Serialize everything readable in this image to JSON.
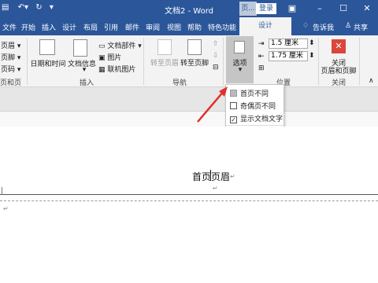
{
  "titlebar": {
    "doc_title": "文档2 - Word",
    "context_tab_label": "页...",
    "login": "登录",
    "ribbon_display": "▣",
    "minimize": "–",
    "restore": "☐",
    "close": "✕"
  },
  "tabs": [
    "文件",
    "开始",
    "插入",
    "设计",
    "布局",
    "引用",
    "邮件",
    "审阅",
    "视图",
    "帮助",
    "特色功能"
  ],
  "design_tab": "设计",
  "tell_me": "告诉我",
  "share": "共享",
  "ribbon": {
    "header_footer": [
      "页眉 ▾",
      "页脚 ▾",
      "页码 ▾"
    ],
    "header_footer_group": "页和页脚",
    "date_time": "日期和时间",
    "doc_info": "文档信息",
    "doc_parts": "文档部件 ▾",
    "picture": "图片",
    "online_picture": "联机图片",
    "insert_group": "插入",
    "goto_header": "转至页眉",
    "goto_footer": "转至页脚",
    "nav_group": "导航",
    "options": "选项",
    "header_pos": "1.5 厘米",
    "footer_pos": "1.75 厘米",
    "position_group": "位置",
    "close_line1": "关闭",
    "close_line2": "页眉和页脚",
    "close_group": "关闭"
  },
  "options_dropdown": {
    "different_first": "首页不同",
    "different_odd_even": "奇偶页不同",
    "show_doc_text": "显示文档文字",
    "show_doc_text_checked": "✓",
    "footer": "选项"
  },
  "document": {
    "header_text": "首页页眉",
    "para_mark": "↵"
  },
  "colors": {
    "accent": "#2b579a",
    "arrow": "#e0302a",
    "close_icon": "#d9483b"
  }
}
